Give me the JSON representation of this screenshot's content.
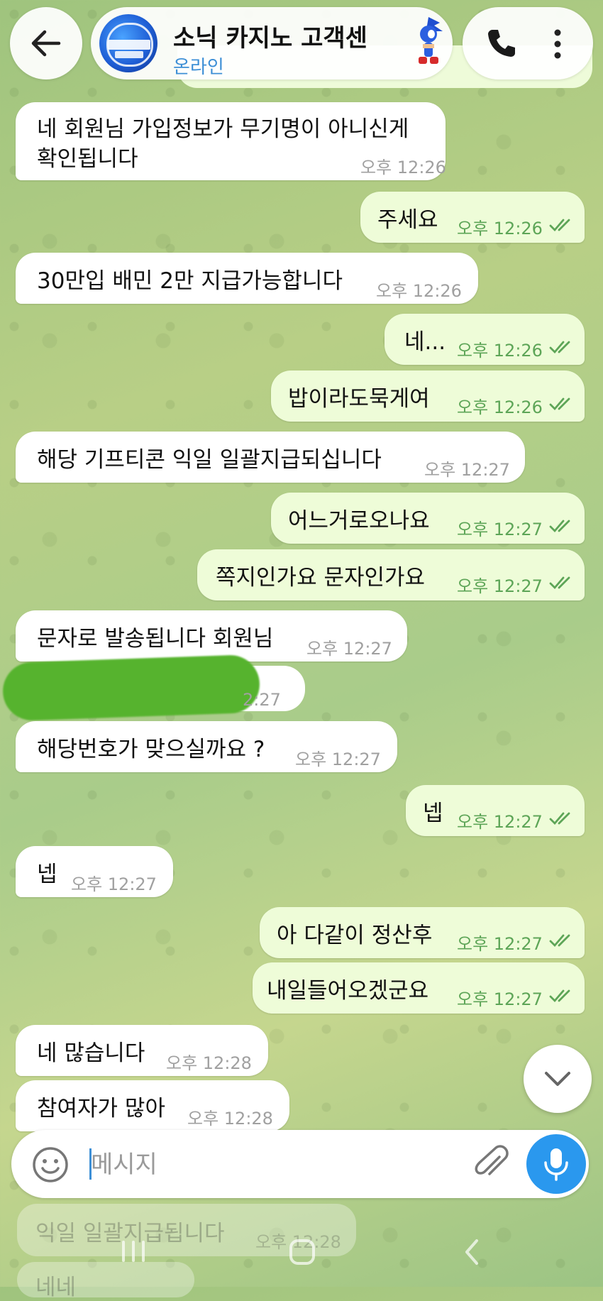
{
  "header": {
    "title": "소닉 카지노 고객센",
    "status": "온라인"
  },
  "messages": [
    {
      "dir": "in",
      "text": "네 회원님 가입정보가 무기명이 아니신게",
      "text2": "확인됩니다",
      "time": "오후 12:26"
    },
    {
      "dir": "out",
      "text": "주세요",
      "time": "오후 12:26"
    },
    {
      "dir": "in",
      "text": "30만입 배민 2만 지급가능합니다",
      "time": "오후 12:26"
    },
    {
      "dir": "out",
      "text": "네...",
      "time": "오후 12:26"
    },
    {
      "dir": "out",
      "text": "밥이라도묵게여",
      "time": "오후 12:26"
    },
    {
      "dir": "in",
      "text": "해당 기프티콘 익일 일괄지급되십니다",
      "time": "오후 12:27"
    },
    {
      "dir": "out",
      "text": "어느거로오나요",
      "time": "오후 12:27"
    },
    {
      "dir": "out",
      "text": "쪽지인가요 문자인가요",
      "time": "오후 12:27"
    },
    {
      "dir": "in",
      "text": "문자로 발송됩니다 회원님",
      "time": "오후 12:27"
    },
    {
      "dir": "in",
      "text": "",
      "time": "2:27"
    },
    {
      "dir": "in",
      "text": "해당번호가 맞으실까요 ?",
      "time": "오후 12:27"
    },
    {
      "dir": "out",
      "text": "넵",
      "time": "오후 12:27"
    },
    {
      "dir": "in",
      "text": "넵",
      "time": "오후 12:27"
    },
    {
      "dir": "out",
      "text": "아 다같이 정산후",
      "time": "오후 12:27"
    },
    {
      "dir": "out",
      "text": "내일들어오겠군요",
      "time": "오후 12:27"
    },
    {
      "dir": "in",
      "text": "네 많습니다",
      "time": "오후 12:28"
    },
    {
      "dir": "in",
      "text": "참여자가 많아",
      "time": "오후 12:28"
    }
  ],
  "input": {
    "placeholder": "메시지"
  },
  "ghost": [
    {
      "text": "익일 일괄지급됩니다",
      "time": "오후 12:28"
    },
    {
      "text": "네네",
      "time": ""
    }
  ],
  "icons": {
    "back": "arrow-left-icon",
    "call": "phone-icon",
    "more": "more-vertical-icon",
    "emoji": "emoji-icon",
    "attach": "paperclip-icon",
    "mic": "microphone-icon",
    "scroll": "chevron-down-icon",
    "read": "double-check-icon"
  },
  "colors": {
    "outgoing_bubble": "#eefcd8",
    "incoming_bubble": "#ffffff",
    "accent": "#2a98ee",
    "read_ticks": "#5da557",
    "status": "#3d8fd6"
  }
}
